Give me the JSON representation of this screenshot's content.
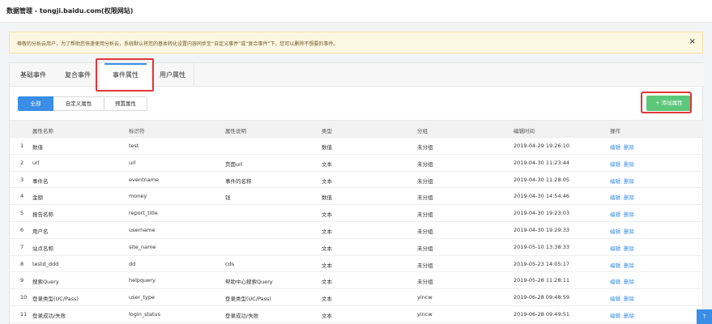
{
  "header": {
    "title": "数据管理 - tongji.baidu.com(权限网站)"
  },
  "notice": {
    "text": "尊敬的分析云用户，为了帮助您快速使用分析云，系统默认将您的基本转化设置内容同步至“自定义事件”或“复合事件”下，您可以删除不想要的事件。",
    "close_icon": "×"
  },
  "tabs": [
    {
      "label": "基础事件"
    },
    {
      "label": "复合事件"
    },
    {
      "label": "事件属性"
    },
    {
      "label": "用户属性"
    }
  ],
  "filters": [
    {
      "label": "全部"
    },
    {
      "label": "自定义属性"
    },
    {
      "label": "预置属性"
    }
  ],
  "add_button": {
    "label": "+ 添加属性"
  },
  "table": {
    "headers": [
      "属性名称",
      "标识符",
      "属性说明",
      "类型",
      "分组",
      "编辑时间",
      "操作"
    ],
    "rows": [
      {
        "no": "1",
        "name": "数值",
        "id": "test",
        "desc": "",
        "type": "数值",
        "group": "未分组",
        "time": "2019-04-29 19:26:10",
        "edit": "编辑",
        "del": "删除"
      },
      {
        "no": "2",
        "name": "url",
        "id": "url",
        "desc": "页面url",
        "type": "文本",
        "group": "未分组",
        "time": "2019-04-30 11:23:44",
        "edit": "编辑",
        "del": "删除"
      },
      {
        "no": "3",
        "name": "事件名",
        "id": "eventname",
        "desc": "事件的名称",
        "type": "文本",
        "group": "未分组",
        "time": "2019-04-30 11:28:05",
        "edit": "编辑",
        "del": "删除"
      },
      {
        "no": "4",
        "name": "金额",
        "id": "money",
        "desc": "钱",
        "type": "数值",
        "group": "未分组",
        "time": "2019-04-30 14:54:46",
        "edit": "编辑",
        "del": "删除"
      },
      {
        "no": "5",
        "name": "报告名称",
        "id": "report_title",
        "desc": "",
        "type": "文本",
        "group": "未分组",
        "time": "2019-04-30 19:23:03",
        "edit": "编辑",
        "del": "删除"
      },
      {
        "no": "6",
        "name": "用户名",
        "id": "username",
        "desc": "",
        "type": "文本",
        "group": "未分组",
        "time": "2019-04-30 19:29:33",
        "edit": "编辑",
        "del": "删除"
      },
      {
        "no": "7",
        "name": "站点名称",
        "id": "site_name",
        "desc": "",
        "type": "文本",
        "group": "未分组",
        "time": "2019-05-10 13:38:33",
        "edit": "编辑",
        "del": "删除"
      },
      {
        "no": "8",
        "name": "testd_ddd",
        "id": "dd",
        "desc": "cds",
        "type": "文本",
        "group": "未分组",
        "time": "2019-05-23 14:05:17",
        "edit": "编辑",
        "del": "删除"
      },
      {
        "no": "9",
        "name": "搜索Query",
        "id": "helpquery",
        "desc": "帮助中心搜索Query",
        "type": "文本",
        "group": "未分组",
        "time": "2019-05-28 11:28:11",
        "edit": "编辑",
        "del": "删除"
      },
      {
        "no": "10",
        "name": "登录类型(UC/Pass)",
        "id": "user_type",
        "desc": "登录类型(UC/Pass)",
        "type": "文本",
        "group": "yincw",
        "time": "2019-06-28 09:48:59",
        "edit": "编辑",
        "del": "删除"
      },
      {
        "no": "11",
        "name": "登录成功/失败",
        "id": "login_status",
        "desc": "登录成功/失败",
        "type": "文本",
        "group": "yincw",
        "time": "2019-06-28 09:49:51",
        "edit": "编辑",
        "del": "删除"
      }
    ]
  },
  "corner_widget": {
    "icon": "help-icon"
  },
  "colors": {
    "accent": "#3a8ee6",
    "add_button": "#5cc87a",
    "highlight": "#e0363a",
    "notice_bg": "#fcf7e1"
  }
}
